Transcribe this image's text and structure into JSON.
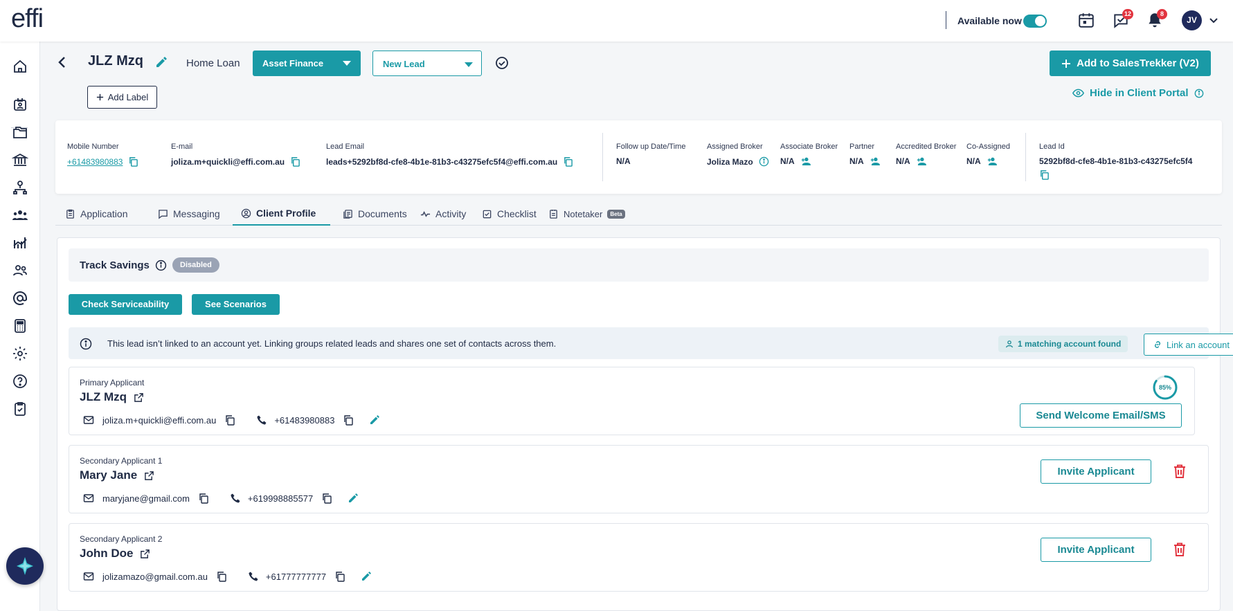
{
  "topbar": {
    "logo": "effi",
    "availability_label": "Available now",
    "availability_on": true,
    "icons": [
      "calendar-icon",
      "tasks-icon",
      "bell-icon"
    ],
    "tasks_badge": "12",
    "notifications_badge": "8",
    "avatar_initials": "JV"
  },
  "sidebar": {
    "icons": [
      "home-icon",
      "contacts-icon",
      "folders-icon",
      "bank-icon",
      "org-chart-icon",
      "team-icon",
      "analytics-icon",
      "users-icon",
      "at-icon",
      "calculator-icon",
      "settings-icon",
      "help-icon",
      "clipboard-icon"
    ]
  },
  "header": {
    "name": "JLZ Mzq",
    "loan_type": "Home Loan",
    "finance_select": "Asset Finance",
    "status_select": "New Lead",
    "add_to_salestrekker": "Add to SalesTrekker (V2)",
    "add_label": "Add Label",
    "hide_in_portal": "Hide in Client Portal"
  },
  "info": {
    "mobile_label": "Mobile Number",
    "mobile": "+61483980883",
    "email_label": "E-mail",
    "email": "joliza.m+quickli@effi.com.au",
    "lead_email_label": "Lead Email",
    "lead_email": "leads+5292bf8d-cfe8-4b1e-81b3-c43275efc5f4@effi.com.au",
    "followup_label": "Follow up Date/Time",
    "followup": "N/A",
    "assigned_label": "Assigned Broker",
    "assigned": "Joliza Mazo",
    "associate_label": "Associate Broker",
    "associate": "N/A",
    "partner_label": "Partner",
    "partner": "N/A",
    "accredited_label": "Accredited Broker",
    "accredited": "N/A",
    "coassigned_label": "Co-Assigned",
    "coassigned": "N/A",
    "leadid_label": "Lead Id",
    "leadid": "5292bf8d-cfe8-4b1e-81b3-c43275efc5f4"
  },
  "tabs": [
    {
      "label": "Application",
      "icon": "application-icon"
    },
    {
      "label": "Messaging",
      "icon": "message-icon"
    },
    {
      "label": "Client Profile",
      "icon": "profile-icon",
      "active": true
    },
    {
      "label": "Documents",
      "icon": "documents-icon"
    },
    {
      "label": "Activity",
      "icon": "activity-icon"
    },
    {
      "label": "Checklist",
      "icon": "checklist-icon"
    },
    {
      "label": "Notetaker",
      "icon": "notetaker-icon",
      "badge": "Beta"
    }
  ],
  "profile": {
    "track_savings": "Track Savings",
    "track_status": "Disabled",
    "check_serviceability": "Check Serviceability",
    "see_scenarios": "See Scenarios",
    "notice": "This lead isn’t linked to an account yet. Linking groups related leads and shares one set of contacts across them.",
    "match_found": "1 matching account found",
    "link_account": "Link an account"
  },
  "applicants": [
    {
      "kind": "Primary Applicant",
      "name": "JLZ Mzq",
      "email": "joliza.m+quickli@effi.com.au",
      "phone": "+61483980883",
      "completion_pct": 85,
      "completion_label": "85%",
      "action": "Send Welcome Email/SMS"
    },
    {
      "kind": "Secondary Applicant 1",
      "name": "Mary Jane",
      "email": "maryjane@gmail.com",
      "phone": "+619998885577",
      "action": "Invite Applicant"
    },
    {
      "kind": "Secondary Applicant 2",
      "name": "John Doe",
      "email": "jolizamazo@gmail.com.au",
      "phone": "+61777777777",
      "action": "Invite Applicant"
    }
  ],
  "colors": {
    "accent": "#1a9aa6",
    "navy": "#1f2a5c",
    "danger": "#e2343f"
  }
}
